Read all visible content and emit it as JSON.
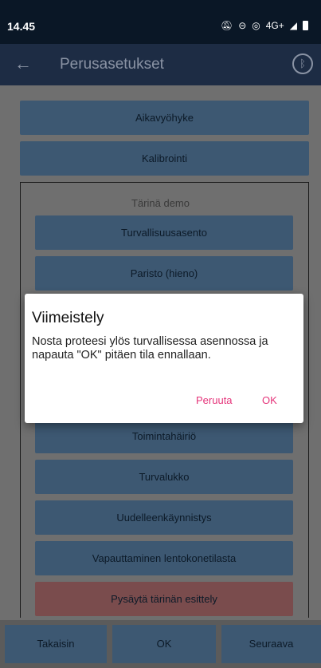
{
  "status_bar": {
    "time": "14.45",
    "network": "4G+"
  },
  "app_bar": {
    "title": "Perusasetukset"
  },
  "main": {
    "timezone_button": "Aikavyöhyke",
    "calibration_button": "Kalibrointi",
    "demo_section_title": "Tärinä demo",
    "demo_items": [
      "Turvallisuusasento",
      "Paristo (hieno)",
      "Toimintahäiriö",
      "Turvalukko",
      "Uudelleenkäynnistys",
      "Vapauttaminen lentokonetilasta",
      "Pysäytä tärinän esittely"
    ]
  },
  "bottom_bar": {
    "back_label": "Takaisin",
    "ok_label": "OK",
    "next_label": "Seuraava"
  },
  "dialog": {
    "title": "Viimeistely",
    "message": "Nosta proteesi ylös turvallisessa asennossa ja napauta \"OK\" pitäen tila ennallaan.",
    "cancel_label": "Peruuta",
    "ok_label": "OK"
  },
  "colors": {
    "accent": "#e5347a",
    "button_bg": "#3d5872",
    "stop_bg": "#7a4c4d"
  }
}
